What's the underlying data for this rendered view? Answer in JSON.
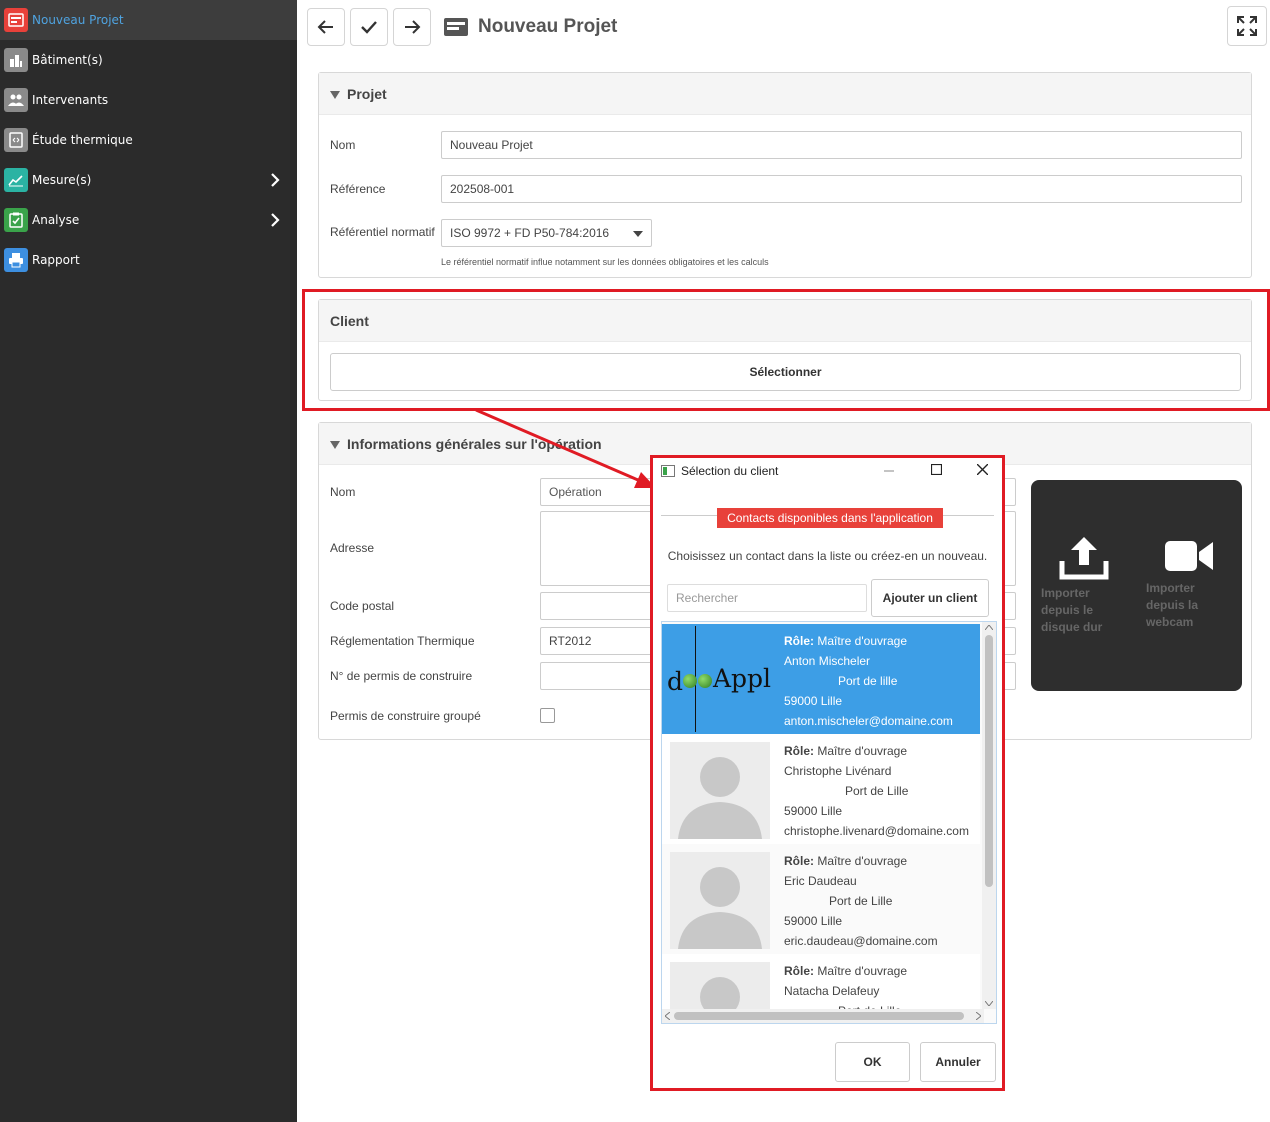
{
  "sidebar": {
    "items": [
      {
        "label": "Nouveau Projet",
        "icon": "project-icon",
        "color": "#e8413a"
      },
      {
        "label": "Bâtiment(s)",
        "icon": "building-icon",
        "color": "#8a8a8a"
      },
      {
        "label": "Intervenants",
        "icon": "people-icon",
        "color": "#8a8a8a"
      },
      {
        "label": "Étude thermique",
        "icon": "thermal-study-icon",
        "color": "#8a8a8a"
      },
      {
        "label": "Mesure(s)",
        "icon": "chart-icon",
        "color": "#2bb3a3"
      },
      {
        "label": "Analyse",
        "icon": "clipboard-check-icon",
        "color": "#3aa34a"
      },
      {
        "label": "Rapport",
        "icon": "printer-icon",
        "color": "#3d8fe0"
      }
    ]
  },
  "header": {
    "title": "Nouveau Projet"
  },
  "projet": {
    "title": "Projet",
    "nom_label": "Nom",
    "nom_value": "Nouveau Projet",
    "ref_label": "Référence",
    "ref_value": "202508-001",
    "refnorm_label": "Référentiel normatif",
    "refnorm_value": "ISO 9972 + FD P50-784:2016",
    "refnorm_hint": "Le référentiel normatif influe notamment sur les données obligatoires et les calculs"
  },
  "client": {
    "title": "Client",
    "select_label": "Sélectionner"
  },
  "infos": {
    "title": "Informations générales sur l'opération",
    "nom_label": "Nom",
    "nom_placeholder": "Opération",
    "adresse_label": "Adresse",
    "cp_label": "Code postal",
    "reglementation_label": "Réglementation Thermique",
    "reglementation_value": "RT2012",
    "permis_label": "N° de permis de construire",
    "permis_groupe_label": "Permis de construire groupé",
    "import_disk": "Importer depuis le disque dur",
    "import_webcam": "Importer depuis la webcam"
  },
  "dialog": {
    "title": "Sélection du client",
    "badge": "Contacts disponibles dans l'application",
    "instruction": "Choisissez un contact dans la liste ou créez-en un nouveau.",
    "search_placeholder": "Rechercher",
    "add_label": "Ajouter un client",
    "ok_label": "OK",
    "cancel_label": "Annuler",
    "logo_text": "Appl",
    "contacts": [
      {
        "role_label": "Rôle:",
        "role": "Maître d'ouvrage",
        "name": "Anton Mischeler",
        "address": "Port de lille",
        "city": "59000  Lille",
        "email": "anton.mischeler@domaine.com"
      },
      {
        "role_label": "Rôle:",
        "role": "Maître d'ouvrage",
        "name": "Christophe Livénard",
        "address": "Port de Lille",
        "city": "59000  Lille",
        "email": "christophe.livenard@domaine.com"
      },
      {
        "role_label": "Rôle:",
        "role": "Maître d'ouvrage",
        "name": "Eric Daudeau",
        "address": "Port de Lille",
        "city": "59000  Lille",
        "email": "eric.daudeau@domaine.com"
      },
      {
        "role_label": "Rôle:",
        "role": "Maître d'ouvrage",
        "name": "Natacha Delafeuy",
        "address": "Port de Lille",
        "city": "",
        "email": ""
      }
    ]
  }
}
